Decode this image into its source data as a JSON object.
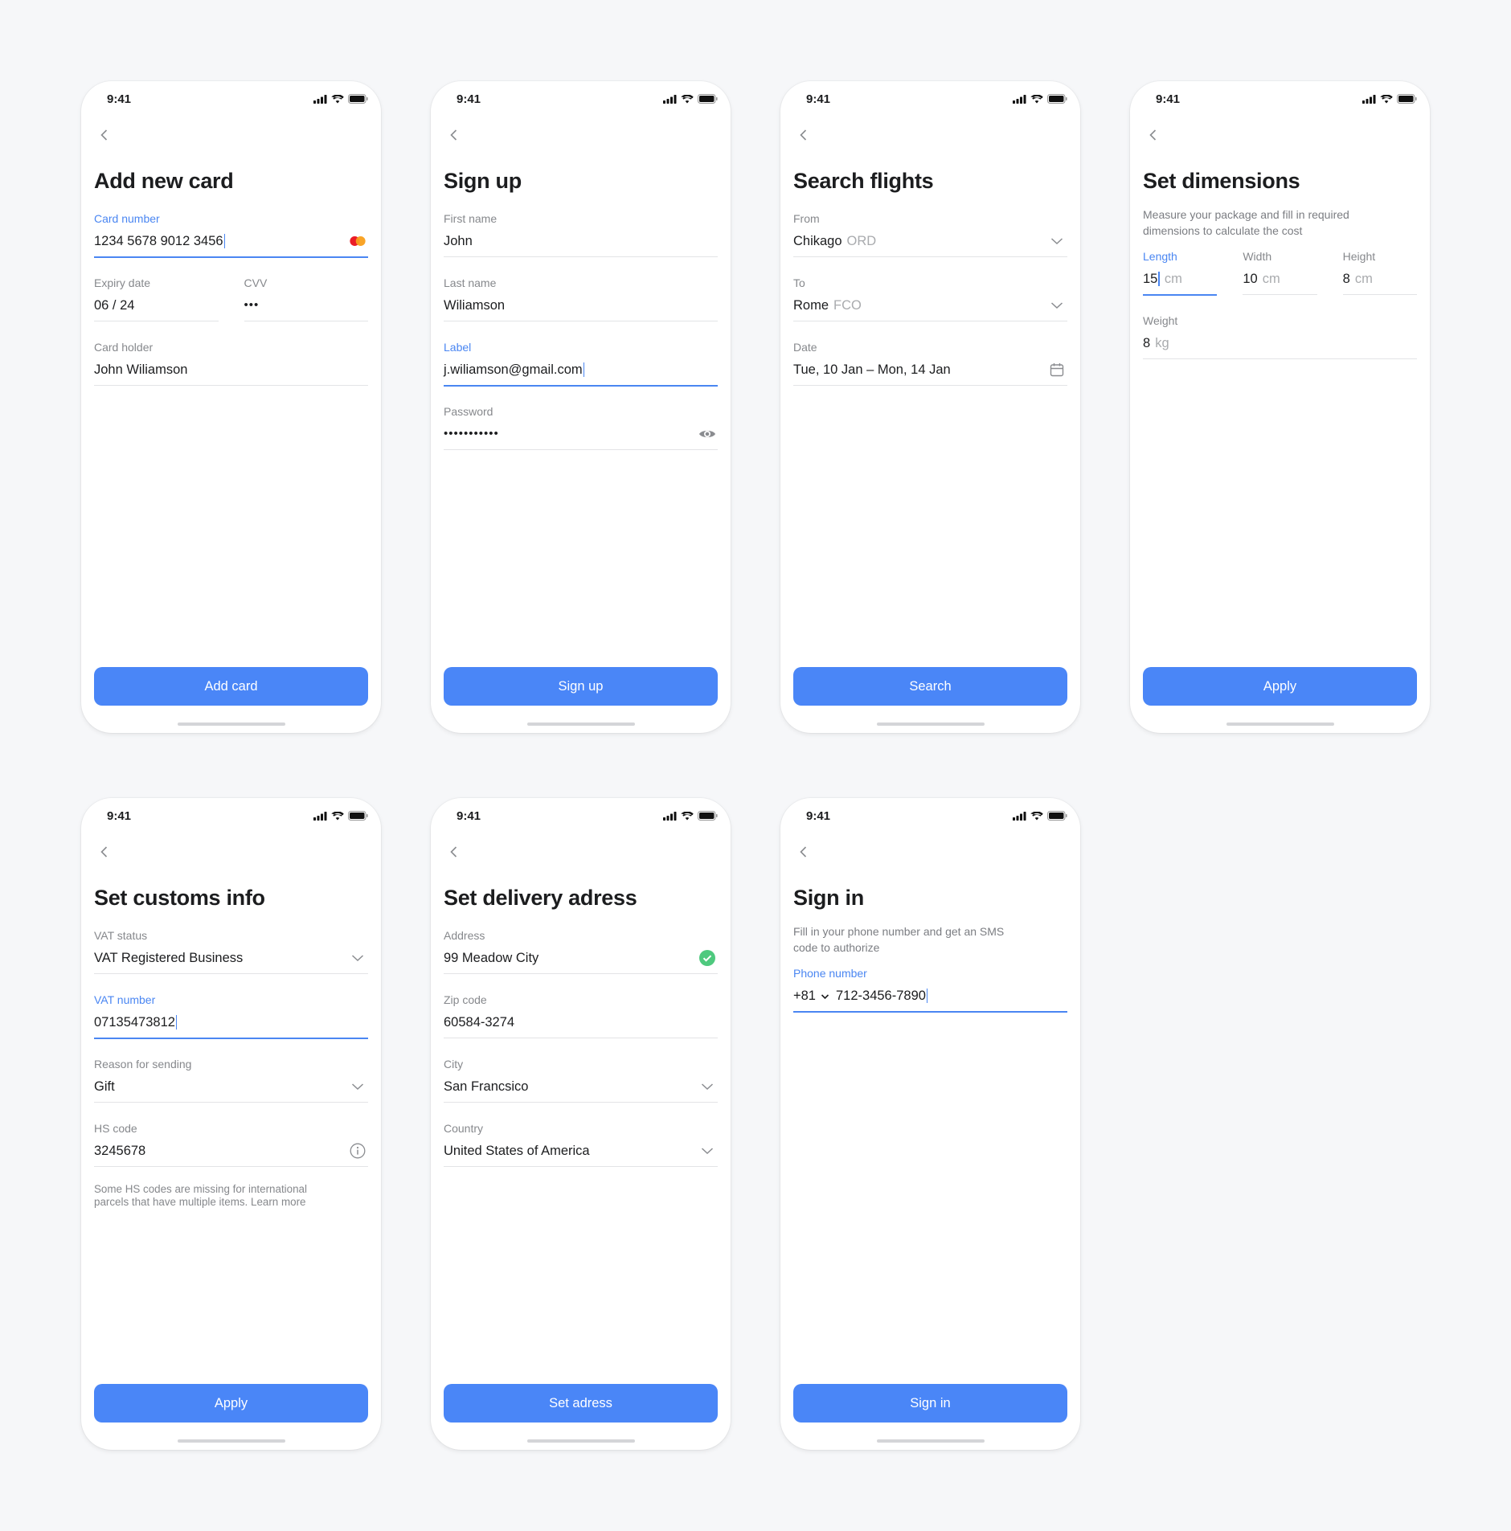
{
  "status_time": "9:41",
  "colors": {
    "accent": "#4a86f7",
    "background": "#f6f7f9",
    "success": "#4ec97e"
  },
  "screens": [
    {
      "id": "add-card",
      "title": "Add new card",
      "button": "Add card",
      "fields": [
        {
          "label": "Card number",
          "value": "1234 5678 9012 3456",
          "focused": true,
          "icon": "mastercard-icon"
        },
        {
          "row": [
            {
              "label": "Expiry date",
              "value": "06 / 24"
            },
            {
              "label": "CVV",
              "value": "•••",
              "dots": true
            }
          ]
        },
        {
          "label": "Card holder",
          "value": "John Wiliamson"
        }
      ]
    },
    {
      "id": "sign-up",
      "title": "Sign up",
      "button": "Sign up",
      "fields": [
        {
          "label": "First name",
          "value": "John"
        },
        {
          "label": "Last name",
          "value": "Wiliamson"
        },
        {
          "label": "Label",
          "value": "j.wiliamson@gmail.com",
          "focused": true
        },
        {
          "label": "Password",
          "value": "•••••••••••",
          "dots": true,
          "icon": "eye-icon"
        }
      ]
    },
    {
      "id": "search-flights",
      "title": "Search flights",
      "button": "Search",
      "fields": [
        {
          "label": "From",
          "value": "Chikago",
          "suffix": "ORD",
          "icon": "chevron-down-icon"
        },
        {
          "label": "To",
          "value": "Rome",
          "suffix": "FCO",
          "icon": "chevron-down-icon"
        },
        {
          "label": "Date",
          "value": "Tue, 10 Jan – Mon, 14 Jan",
          "icon": "calendar-icon"
        }
      ]
    },
    {
      "id": "set-dimensions",
      "title": "Set dimensions",
      "subtitle": "Measure your package and fill in required dimensions to calculate the cost",
      "button": "Apply",
      "fields": [
        {
          "row": [
            {
              "label": "Length",
              "value": "15",
              "suffix": "cm",
              "focused": true
            },
            {
              "label": "Width",
              "value": "10",
              "suffix": "cm"
            },
            {
              "label": "Height",
              "value": "8",
              "suffix": "cm"
            }
          ]
        },
        {
          "label": "Weight",
          "value": "8",
          "suffix": "kg"
        }
      ]
    },
    {
      "id": "customs-info",
      "title": "Set customs info",
      "button": "Apply",
      "helper": "Some HS codes are missing for international parcels that have multiple items. Learn more",
      "fields": [
        {
          "label": "VAT status",
          "value": "VAT Registered Business",
          "icon": "chevron-down-icon"
        },
        {
          "label": "VAT number",
          "value": "07135473812",
          "focused": true
        },
        {
          "label": "Reason for sending",
          "value": "Gift",
          "icon": "chevron-down-icon"
        },
        {
          "label": "HS code",
          "value": "3245678",
          "icon": "info-icon"
        }
      ]
    },
    {
      "id": "delivery-address",
      "title": "Set delivery adress",
      "button": "Set adress",
      "fields": [
        {
          "label": "Address",
          "value": "99 Meadow City",
          "icon": "check-circle-icon"
        },
        {
          "label": "Zip code",
          "value": "60584-3274"
        },
        {
          "label": "City",
          "value": "San Francsico",
          "icon": "chevron-down-icon"
        },
        {
          "label": "Country",
          "value": "United States of America",
          "icon": "chevron-down-icon"
        }
      ]
    },
    {
      "id": "sign-in",
      "title": "Sign in",
      "subtitle": "Fill in your phone number and get an SMS code to authorize",
      "button": "Sign in",
      "fields": [
        {
          "label": "Phone number",
          "country_code": "+81",
          "value": "712-3456-7890",
          "focused": true
        }
      ]
    }
  ]
}
